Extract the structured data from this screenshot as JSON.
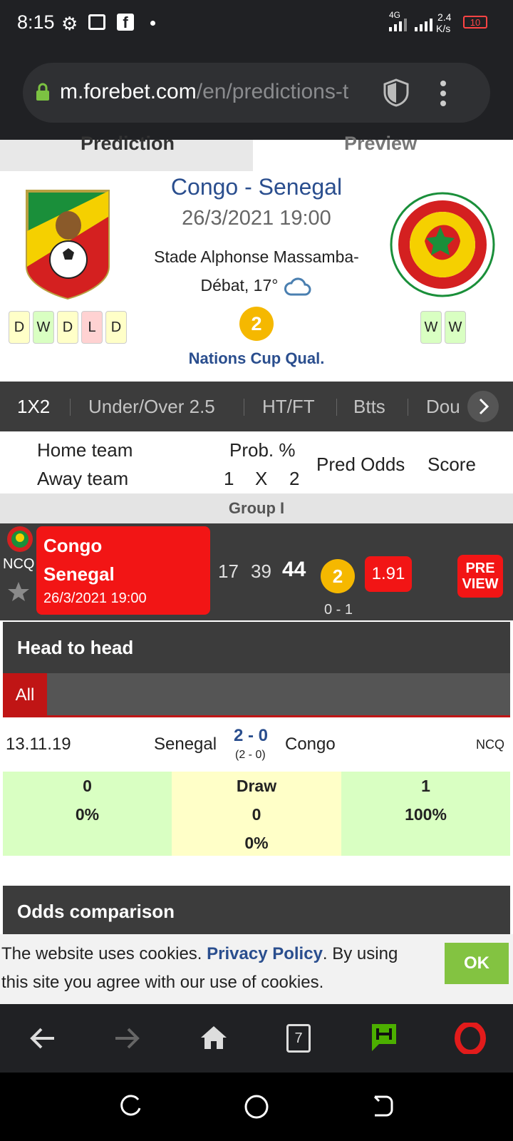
{
  "status_bar": {
    "time": "8:15",
    "network": "4G",
    "speed": "2.4",
    "speed_unit": "K/s",
    "battery": "10"
  },
  "browser": {
    "url_domain": "m.forebet.com",
    "url_path": "/en/predictions-t"
  },
  "page_tabs": {
    "prediction": "Prediction",
    "preview": "Preview"
  },
  "match": {
    "title": "Congo - Senegal",
    "datetime": "26/3/2021 19:00",
    "stadium": "Stade Alphonse Massamba-Débat, 17°",
    "prediction": "2",
    "league": "Nations Cup Qual.",
    "home_form": [
      "D",
      "W",
      "D",
      "L",
      "D"
    ],
    "away_form": [
      "W",
      "W"
    ]
  },
  "market_tabs": [
    "1X2",
    "Under/Over 2.5",
    "HT/FT",
    "Btts",
    "Dou"
  ],
  "table_header": {
    "home": "Home team",
    "away": "Away team",
    "prob": "Prob. %",
    "p1": "1",
    "px": "X",
    "p2": "2",
    "pred_odds": "Pred Odds",
    "score": "Score"
  },
  "group": "Group I",
  "row": {
    "league_code": "NCQ",
    "home": "Congo",
    "away": "Senegal",
    "datetime": "26/3/2021 19:00",
    "p1": "17",
    "px": "39",
    "p2": "44",
    "pred": "2",
    "score": "0 - 1",
    "odds": "1.91",
    "preview_line1": "PRE",
    "preview_line2": "VIEW"
  },
  "h2h": {
    "title": "Head to head",
    "tab_all": "All",
    "date": "13.11.19",
    "home": "Senegal",
    "score": "2 - 0",
    "ht_score": "(2 - 0)",
    "away": "Congo",
    "league": "NCQ",
    "stats": {
      "home_count": "0",
      "home_pct": "0%",
      "draw_label": "Draw",
      "draw_count": "0",
      "draw_pct": "0%",
      "away_count": "1",
      "away_pct": "100%"
    }
  },
  "odds_title": "Odds comparison",
  "cookie": {
    "text_before": "The website uses cookies. ",
    "link": "Privacy Policy",
    "text_after": ". By using this site you agree with our use of cookies.",
    "ok": "OK"
  },
  "browser_nav": {
    "tab_count": "7"
  },
  "colors": {
    "brand_blue": "#2a4e8e",
    "red": "#f21515",
    "gold": "#f5b800",
    "green_ok": "#83c341"
  }
}
